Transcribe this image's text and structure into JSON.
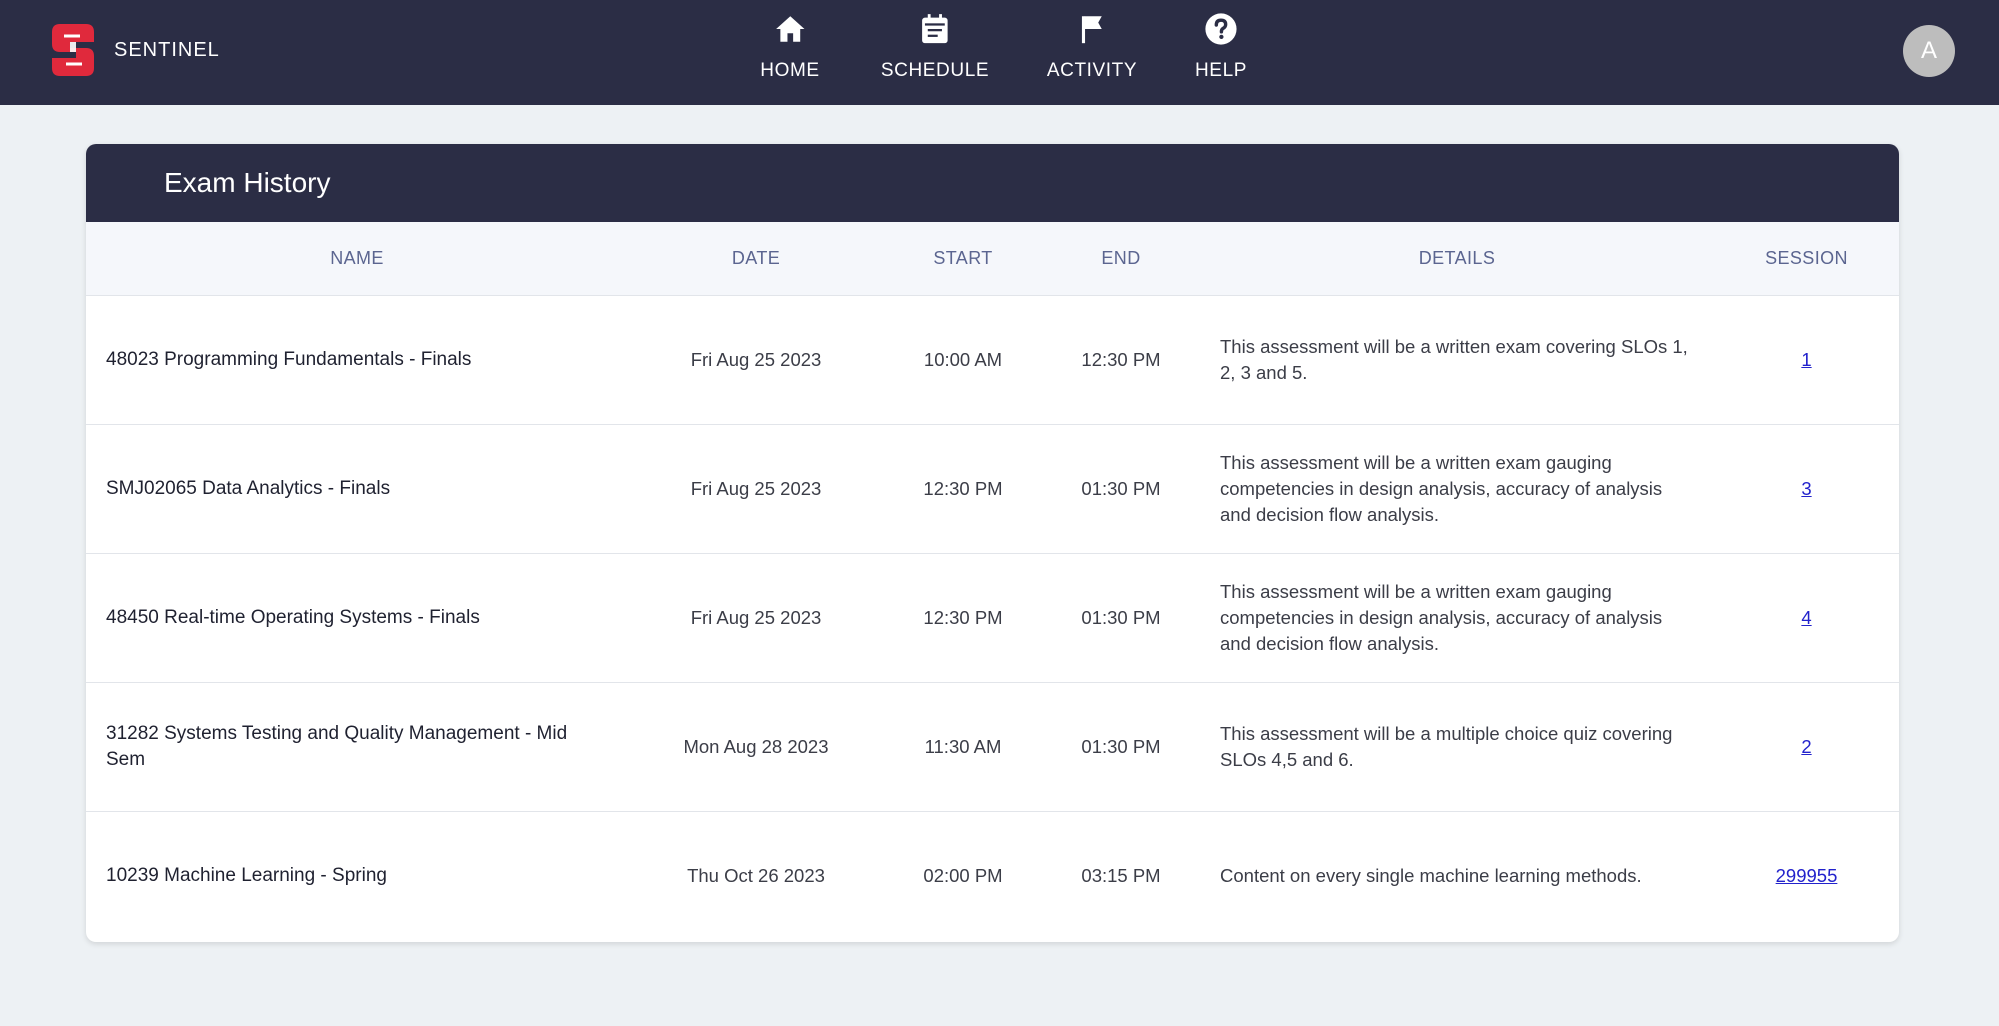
{
  "app": {
    "brand_name": "SENTINEL",
    "colors": {
      "header_bg": "#2b2d45",
      "page_bg": "#edf1f4",
      "brand_red": "#e0293c",
      "link": "#2222cc"
    }
  },
  "nav": {
    "items": [
      {
        "label": "HOME",
        "icon": "home-icon"
      },
      {
        "label": "SCHEDULE",
        "icon": "calendar-icon"
      },
      {
        "label": "ACTIVITY",
        "icon": "flag-icon"
      },
      {
        "label": "HELP",
        "icon": "help-icon"
      }
    ]
  },
  "user": {
    "avatar_initial": "A"
  },
  "exam_history": {
    "title": "Exam History",
    "columns": [
      "NAME",
      "DATE",
      "START",
      "END",
      "DETAILS",
      "SESSION"
    ],
    "rows": [
      {
        "name": "48023 Programming Fundamentals - Finals",
        "date": "Fri Aug 25 2023",
        "start": "10:00 AM",
        "end": "12:30 PM",
        "details": "This assessment will be a written exam covering SLOs 1, 2, 3 and 5.",
        "session": "1"
      },
      {
        "name": "SMJ02065 Data Analytics - Finals",
        "date": "Fri Aug 25 2023",
        "start": "12:30 PM",
        "end": "01:30 PM",
        "details": "This assessment will be a written exam gauging competencies in design analysis, accuracy of analysis and decision flow analysis.",
        "session": "3"
      },
      {
        "name": "48450 Real-time Operating Systems - Finals",
        "date": "Fri Aug 25 2023",
        "start": "12:30 PM",
        "end": "01:30 PM",
        "details": "This assessment will be a written exam gauging competencies in design analysis, accuracy of analysis and decision flow analysis.",
        "session": "4"
      },
      {
        "name": "31282 Systems Testing and Quality Management - Mid Sem",
        "date": "Mon Aug 28 2023",
        "start": "11:30 AM",
        "end": "01:30 PM",
        "details": "This assessment will be a multiple choice quiz covering SLOs 4,5 and 6.",
        "session": "2"
      },
      {
        "name": "10239 Machine Learning - Spring",
        "date": "Thu Oct 26 2023",
        "start": "02:00 PM",
        "end": "03:15 PM",
        "details": "Content on every single machine learning methods.",
        "session": "299955"
      }
    ]
  }
}
